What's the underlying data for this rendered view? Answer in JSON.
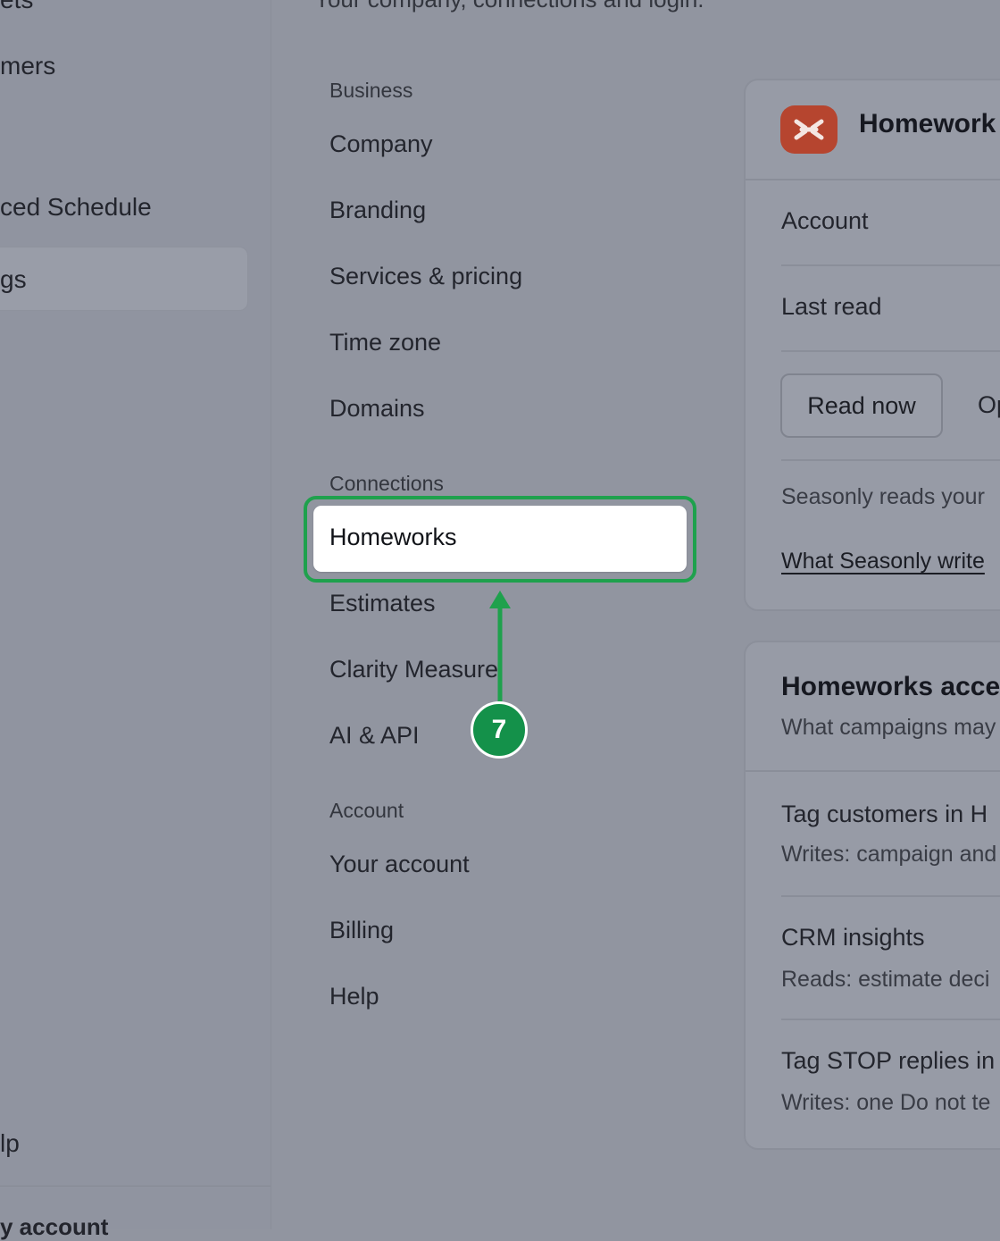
{
  "sidebar": {
    "items": [
      {
        "label": "ets"
      },
      {
        "label": "mers"
      },
      {
        "label": "ced Schedule"
      },
      {
        "label": "gs"
      },
      {
        "label": "lp"
      },
      {
        "label": "y account"
      }
    ]
  },
  "header": {
    "subtitle": "Your company, connections and login."
  },
  "nav": {
    "business_label": "Business",
    "business": [
      "Company",
      "Branding",
      "Services & pricing",
      "Time zone",
      "Domains"
    ],
    "connections_label": "Connections",
    "selected": "Homeworks",
    "connections": [
      "Estimates",
      "Clarity Measure",
      "AI & API"
    ],
    "account_label": "Account",
    "account": [
      "Your account",
      "Billing",
      "Help"
    ]
  },
  "annotation": {
    "step": "7",
    "color": "#1fa14d"
  },
  "integration_card": {
    "title": "Homework",
    "account_label": "Account",
    "last_read_label": "Last read",
    "read_now_button": "Read now",
    "second_button": "Op",
    "description": "Seasonly reads your",
    "link": "What Seasonly write"
  },
  "access_card": {
    "title": "Homeworks acce",
    "subtitle": "What campaigns may",
    "rows": [
      {
        "title": "Tag customers in H",
        "desc": "Writes: campaign and"
      },
      {
        "title": "CRM insights",
        "desc": "Reads: estimate deci"
      },
      {
        "title": "Tag STOP replies in",
        "desc": "Writes: one Do not te"
      }
    ]
  }
}
